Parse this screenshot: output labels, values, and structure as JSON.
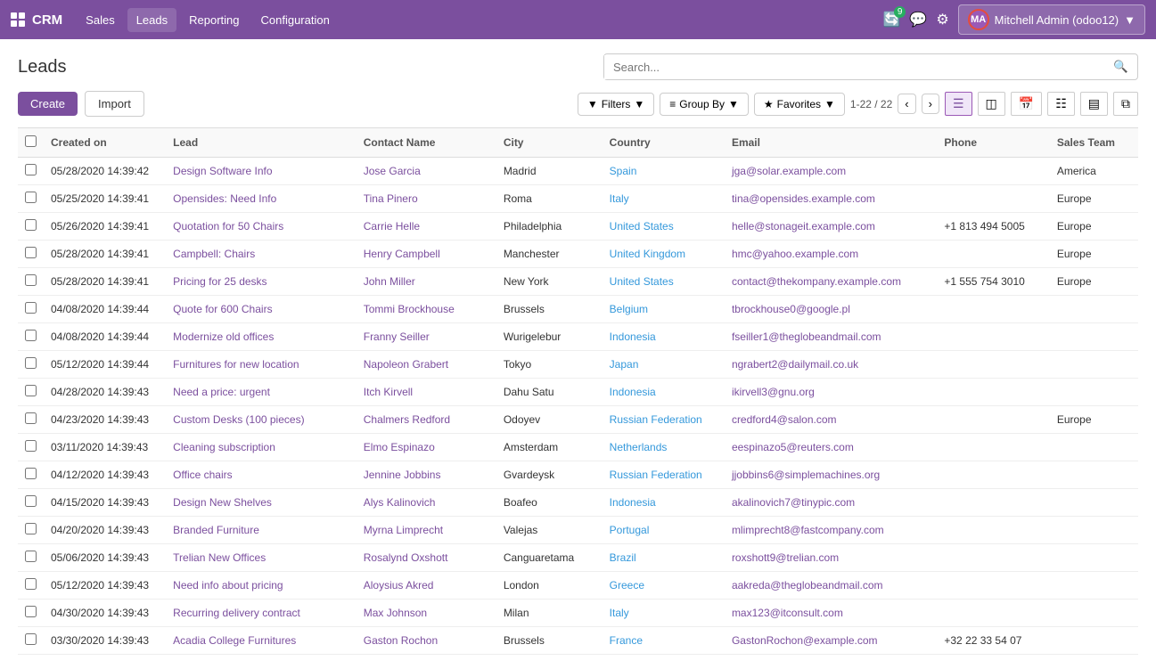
{
  "navbar": {
    "logo": "CRM",
    "nav_items": [
      "Sales",
      "Leads",
      "Reporting",
      "Configuration"
    ],
    "notification_count": "9",
    "user": "Mitchell Admin (odoo12)"
  },
  "page": {
    "title": "Leads",
    "search_placeholder": "Search..."
  },
  "toolbar": {
    "create_label": "Create",
    "import_label": "Import",
    "filters_label": "Filters",
    "groupby_label": "Group By",
    "favorites_label": "Favorites",
    "pagination": "1-22 / 22"
  },
  "table": {
    "columns": [
      "Created on",
      "Lead",
      "Contact Name",
      "City",
      "Country",
      "Email",
      "Phone",
      "Sales Team"
    ],
    "rows": [
      {
        "created_on": "05/28/2020 14:39:42",
        "lead": "Design Software Info",
        "contact_name": "Jose Garcia",
        "city": "Madrid",
        "country": "Spain",
        "email": "jga@solar.example.com",
        "phone": "",
        "sales_team": "America"
      },
      {
        "created_on": "05/25/2020 14:39:41",
        "lead": "Opensides: Need Info",
        "contact_name": "Tina Pinero",
        "city": "Roma",
        "country": "Italy",
        "email": "tina@opensides.example.com",
        "phone": "",
        "sales_team": "Europe"
      },
      {
        "created_on": "05/26/2020 14:39:41",
        "lead": "Quotation for 50 Chairs",
        "contact_name": "Carrie Helle",
        "city": "Philadelphia",
        "country": "United States",
        "email": "helle@stonageit.example.com",
        "phone": "+1 813 494 5005",
        "sales_team": "Europe"
      },
      {
        "created_on": "05/28/2020 14:39:41",
        "lead": "Campbell: Chairs",
        "contact_name": "Henry Campbell",
        "city": "Manchester",
        "country": "United Kingdom",
        "email": "hmc@yahoo.example.com",
        "phone": "",
        "sales_team": "Europe"
      },
      {
        "created_on": "05/28/2020 14:39:41",
        "lead": "Pricing for 25 desks",
        "contact_name": "John Miller",
        "city": "New York",
        "country": "United States",
        "email": "contact@thekompany.example.com",
        "phone": "+1 555 754 3010",
        "sales_team": "Europe"
      },
      {
        "created_on": "04/08/2020 14:39:44",
        "lead": "Quote for 600 Chairs",
        "contact_name": "Tommi Brockhouse",
        "city": "Brussels",
        "country": "Belgium",
        "email": "tbrockhouse0@google.pl",
        "phone": "",
        "sales_team": ""
      },
      {
        "created_on": "04/08/2020 14:39:44",
        "lead": "Modernize old offices",
        "contact_name": "Franny Seiller",
        "city": "Wurigelebur",
        "country": "Indonesia",
        "email": "fseiller1@theglobeandmail.com",
        "phone": "",
        "sales_team": ""
      },
      {
        "created_on": "05/12/2020 14:39:44",
        "lead": "Furnitures for new location",
        "contact_name": "Napoleon Grabert",
        "city": "Tokyo",
        "country": "Japan",
        "email": "ngrabert2@dailymail.co.uk",
        "phone": "",
        "sales_team": ""
      },
      {
        "created_on": "04/28/2020 14:39:43",
        "lead": "Need a price: urgent",
        "contact_name": "Itch Kirvell",
        "city": "Dahu Satu",
        "country": "Indonesia",
        "email": "ikirvell3@gnu.org",
        "phone": "",
        "sales_team": ""
      },
      {
        "created_on": "04/23/2020 14:39:43",
        "lead": "Custom Desks (100 pieces)",
        "contact_name": "Chalmers Redford",
        "city": "Odoyev",
        "country": "Russian Federation",
        "email": "credford4@salon.com",
        "phone": "",
        "sales_team": "Europe"
      },
      {
        "created_on": "03/11/2020 14:39:43",
        "lead": "Cleaning subscription",
        "contact_name": "Elmo Espinazo",
        "city": "Amsterdam",
        "country": "Netherlands",
        "email": "eespinazo5@reuters.com",
        "phone": "",
        "sales_team": ""
      },
      {
        "created_on": "04/12/2020 14:39:43",
        "lead": "Office chairs",
        "contact_name": "Jennine Jobbins",
        "city": "Gvardeysk",
        "country": "Russian Federation",
        "email": "jjobbins6@simplemachines.org",
        "phone": "",
        "sales_team": ""
      },
      {
        "created_on": "04/15/2020 14:39:43",
        "lead": "Design New Shelves",
        "contact_name": "Alys Kalinovich",
        "city": "Boafeo",
        "country": "Indonesia",
        "email": "akalinovich7@tinypic.com",
        "phone": "",
        "sales_team": ""
      },
      {
        "created_on": "04/20/2020 14:39:43",
        "lead": "Branded Furniture",
        "contact_name": "Myrna Limprecht",
        "city": "Valejas",
        "country": "Portugal",
        "email": "mlimprecht8@fastcompany.com",
        "phone": "",
        "sales_team": ""
      },
      {
        "created_on": "05/06/2020 14:39:43",
        "lead": "Trelian New Offices",
        "contact_name": "Rosalynd Oxshott",
        "city": "Canguaretama",
        "country": "Brazil",
        "email": "roxshott9@trelian.com",
        "phone": "",
        "sales_team": ""
      },
      {
        "created_on": "05/12/2020 14:39:43",
        "lead": "Need info about pricing",
        "contact_name": "Aloysius Akred",
        "city": "London",
        "country": "Greece",
        "email": "aakreda@theglobeandmail.com",
        "phone": "",
        "sales_team": ""
      },
      {
        "created_on": "04/30/2020 14:39:43",
        "lead": "Recurring delivery contract",
        "contact_name": "Max Johnson",
        "city": "Milan",
        "country": "Italy",
        "email": "max123@itconsult.com",
        "phone": "",
        "sales_team": ""
      },
      {
        "created_on": "03/30/2020 14:39:43",
        "lead": "Acadia College Furnitures",
        "contact_name": "Gaston Rochon",
        "city": "Brussels",
        "country": "France",
        "email": "GastonRochon@example.com",
        "phone": "+32 22 33 54 07",
        "sales_team": ""
      }
    ]
  }
}
